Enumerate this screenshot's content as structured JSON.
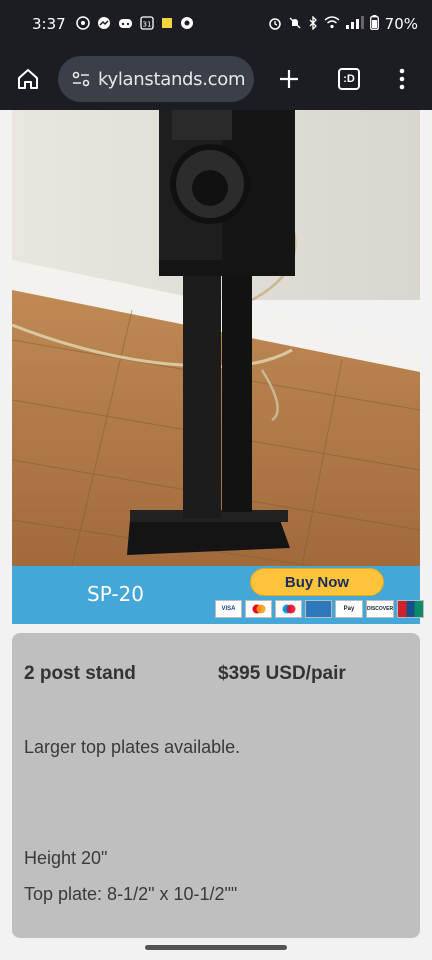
{
  "status_bar": {
    "time": "3:37",
    "battery": "70%",
    "notification_icons": [
      "whatsapp-icon",
      "messenger-icon",
      "discord-icon",
      "calendar-icon",
      "notes-icon",
      "chrome-icon"
    ],
    "calendar_day": "31"
  },
  "browser": {
    "url": "kylanstands.com",
    "tab_label": ":D"
  },
  "product": {
    "banner_model": "SP-20",
    "buy_now_label": "Buy Now",
    "payment_methods": [
      "VISA",
      "MC",
      "Maestro",
      "AMEX",
      "Pay",
      "DISCOVER",
      "UPay"
    ],
    "name": "2 post stand",
    "price": "$395 USD/pair",
    "note": "Larger top plates available.",
    "height": "Height 20\"",
    "top_plate": "Top plate: 8-1/2\" x 10-1/2\"\""
  },
  "colors": {
    "chrome_bar": "#1b1d22",
    "banner_blue": "#45a6d8",
    "buy_now_yellow": "#ffc43a",
    "info_card_gray": "#bfbfbf",
    "floor_wood": "#b07a48",
    "stand_black": "#1a1a1a"
  }
}
